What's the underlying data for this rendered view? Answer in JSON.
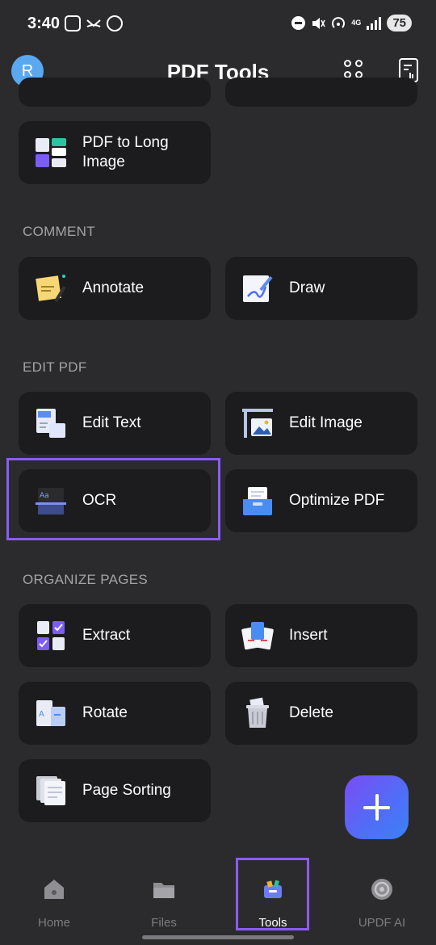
{
  "status_bar": {
    "time": "3:40",
    "network": "4G",
    "battery": "75"
  },
  "header": {
    "avatar_initial": "R",
    "title": "PDF Tools"
  },
  "sections": {
    "convert_tail": {
      "items": [
        {
          "label": "PDF to Long Image",
          "icon": "long-image-icon"
        }
      ]
    },
    "comment": {
      "title": "COMMENT",
      "items": [
        {
          "label": "Annotate",
          "icon": "annotate-icon"
        },
        {
          "label": "Draw",
          "icon": "draw-icon"
        }
      ]
    },
    "edit_pdf": {
      "title": "EDIT PDF",
      "items": [
        {
          "label": "Edit Text",
          "icon": "edit-text-icon"
        },
        {
          "label": "Edit Image",
          "icon": "edit-image-icon"
        },
        {
          "label": "OCR",
          "icon": "ocr-icon"
        },
        {
          "label": "Optimize PDF",
          "icon": "optimize-icon"
        }
      ]
    },
    "organize_pages": {
      "title": "ORGANIZE PAGES",
      "items": [
        {
          "label": "Extract",
          "icon": "extract-icon"
        },
        {
          "label": "Insert",
          "icon": "insert-icon"
        },
        {
          "label": "Rotate",
          "icon": "rotate-icon"
        },
        {
          "label": "Delete",
          "icon": "trash-icon"
        },
        {
          "label": "Page Sorting",
          "icon": "page-sorting-icon"
        }
      ]
    }
  },
  "bottom_nav": {
    "items": [
      {
        "label": "Home",
        "icon": "home-icon"
      },
      {
        "label": "Files",
        "icon": "folder-icon"
      },
      {
        "label": "Tools",
        "icon": "tools-icon",
        "active": true
      },
      {
        "label": "UPDF AI",
        "icon": "ai-icon"
      }
    ]
  },
  "colors": {
    "background": "#2b2b2d",
    "card": "#1c1c1e",
    "highlight": "#8b5cf6",
    "accent": "#7b4cf5"
  }
}
